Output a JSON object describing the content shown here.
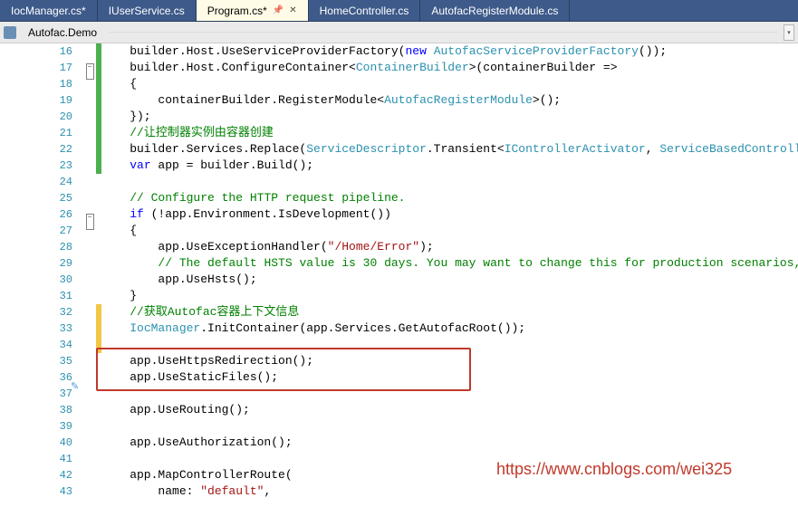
{
  "tabs": [
    {
      "label": "IocManager.cs*",
      "active": false
    },
    {
      "label": "IUserService.cs",
      "active": false
    },
    {
      "label": "Program.cs*",
      "active": true,
      "pinned": true
    },
    {
      "label": "HomeController.cs",
      "active": false
    },
    {
      "label": "AutofacRegisterModule.cs",
      "active": false
    }
  ],
  "context": {
    "namespace": "Autofac.Demo"
  },
  "lines": {
    "start": 16,
    "rows": [
      {
        "n": 16,
        "cb": "g",
        "fold": "",
        "html": "    builder.Host.UseServiceProviderFactory(<span class='kw'>new</span> <span class='typ'>AutofacServiceProviderFactory</span>());"
      },
      {
        "n": 17,
        "cb": "g",
        "fold": "-",
        "html": "    builder.Host.ConfigureContainer&lt;<span class='typ'>ContainerBuilder</span>&gt;(containerBuilder =&gt;"
      },
      {
        "n": 18,
        "cb": "g",
        "fold": "",
        "html": "    {"
      },
      {
        "n": 19,
        "cb": "g",
        "fold": "",
        "html": "        containerBuilder.RegisterModule&lt;<span class='typ'>AutofacRegisterModule</span>&gt;();"
      },
      {
        "n": 20,
        "cb": "g",
        "fold": "",
        "html": "    });"
      },
      {
        "n": 21,
        "cb": "g",
        "fold": "",
        "html": "    <span class='cm'>//让控制器实例由容器创建</span>"
      },
      {
        "n": 22,
        "cb": "g",
        "fold": "",
        "html": "    builder.Services.Replace(<span class='typ'>ServiceDescriptor</span>.Transient&lt;<span class='typ'>IControllerActivator</span>, <span class='typ'>ServiceBasedControllerActivator</span>&gt;"
      },
      {
        "n": 23,
        "cb": "g",
        "fold": "",
        "html": "    <span class='kw'>var</span> app = builder.Build();"
      },
      {
        "n": 24,
        "cb": "",
        "fold": "",
        "html": ""
      },
      {
        "n": 25,
        "cb": "",
        "fold": "",
        "html": "    <span class='cm'>// Configure the HTTP request pipeline.</span>"
      },
      {
        "n": 26,
        "cb": "",
        "fold": "-",
        "html": "    <span class='kw'>if</span> (!app.Environment.IsDevelopment())"
      },
      {
        "n": 27,
        "cb": "",
        "fold": "",
        "html": "    {"
      },
      {
        "n": 28,
        "cb": "",
        "fold": "",
        "html": "        app.UseExceptionHandler(<span class='str'>\"/Home/Error\"</span>);"
      },
      {
        "n": 29,
        "cb": "",
        "fold": "",
        "html": "        <span class='cm'>// The default HSTS value is 30 days. You may want to change this for production scenarios, see </span><span class='lnk'>https:/</span>"
      },
      {
        "n": 30,
        "cb": "",
        "fold": "",
        "html": "        app.UseHsts();"
      },
      {
        "n": 31,
        "cb": "",
        "fold": "",
        "html": "    }"
      },
      {
        "n": 32,
        "cb": "y",
        "fold": "",
        "html": "    <span class='cm'>//获取Autofac容器上下文信息</span>"
      },
      {
        "n": 33,
        "cb": "y",
        "fold": "",
        "html": "    <span class='typ'>IocManager</span>.InitContainer(app.Services.GetAutofacRoot());"
      },
      {
        "n": 34,
        "cb": "y",
        "fold": "",
        "html": ""
      },
      {
        "n": 35,
        "cb": "",
        "fold": "",
        "html": "    app.UseHttpsRedirection();"
      },
      {
        "n": 36,
        "cb": "",
        "fold": "",
        "html": "    app.UseStaticFiles();"
      },
      {
        "n": 37,
        "cb": "",
        "fold": "",
        "html": ""
      },
      {
        "n": 38,
        "cb": "",
        "fold": "",
        "html": "    app.UseRouting();"
      },
      {
        "n": 39,
        "cb": "",
        "fold": "",
        "html": ""
      },
      {
        "n": 40,
        "cb": "",
        "fold": "",
        "html": "    app.UseAuthorization();"
      },
      {
        "n": 41,
        "cb": "",
        "fold": "",
        "html": ""
      },
      {
        "n": 42,
        "cb": "",
        "fold": "",
        "html": "    app.MapControllerRoute("
      },
      {
        "n": 43,
        "cb": "",
        "fold": "",
        "html": "        name: <span class='str'>\"default\"</span>,"
      }
    ]
  },
  "watermark": "https://www.cnblogs.com/wei325"
}
